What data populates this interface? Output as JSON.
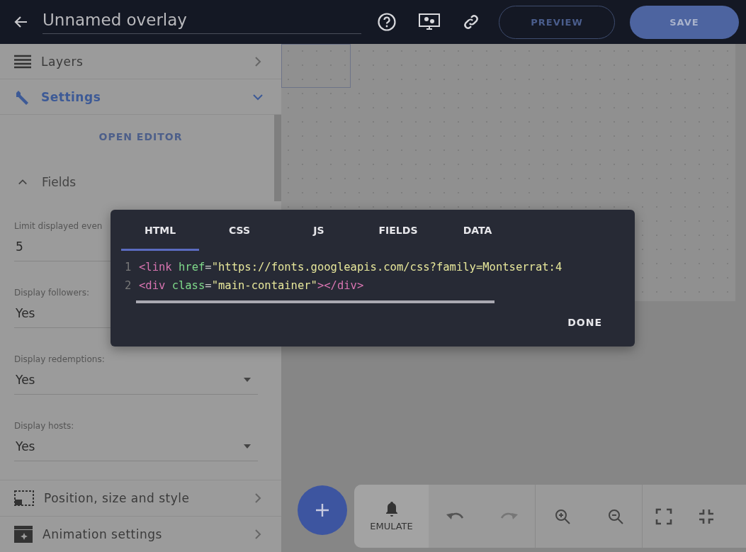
{
  "header": {
    "title": "Unnamed overlay",
    "buttons": [
      {
        "label": "PREVIEW",
        "kind": "outline"
      },
      {
        "label": "SAVE",
        "kind": "filled"
      }
    ]
  },
  "sidebar": {
    "sections": [
      {
        "label": "Layers",
        "kind": "layers",
        "expanded": false,
        "active": false
      },
      {
        "label": "Settings",
        "kind": "settings",
        "expanded": true,
        "active": true
      }
    ],
    "open_editor": "OPEN EDITOR",
    "fields_group": {
      "label": "Fields",
      "expanded": true
    },
    "fields": [
      {
        "label": "Limit displayed even",
        "value": "5",
        "kind": "input"
      },
      {
        "label": "Display followers:",
        "value": "Yes",
        "kind": "input"
      },
      {
        "label": "Display redemptions:",
        "value": "Yes",
        "kind": "select"
      },
      {
        "label": "Display hosts:",
        "value": "Yes",
        "kind": "select"
      }
    ],
    "bottom_sections": [
      {
        "label": "Position, size and style",
        "kind": "position"
      },
      {
        "label": "Animation settings",
        "kind": "animation"
      }
    ]
  },
  "toolbar": {
    "emulate": "EMULATE"
  },
  "editor": {
    "tabs": [
      {
        "label": "HTML",
        "selected": true
      },
      {
        "label": "CSS",
        "selected": false
      },
      {
        "label": "JS",
        "selected": false
      },
      {
        "label": "FIELDS",
        "selected": false
      },
      {
        "label": "DATA",
        "selected": false
      }
    ],
    "lines": [
      {
        "number": "1",
        "tokens": [
          {
            "kind": "tag",
            "text": "<link"
          },
          {
            "kind": "attr",
            "text": "href"
          },
          {
            "kind": "punct",
            "text": "="
          },
          {
            "kind": "string",
            "text": "\"https://fonts.googleapis.com/css?family=Montserrat:4"
          }
        ]
      },
      {
        "number": "2",
        "tokens": [
          {
            "kind": "tag",
            "text": "<div"
          },
          {
            "kind": "attr",
            "text": "class"
          },
          {
            "kind": "punct",
            "text": "="
          },
          {
            "kind": "string",
            "text": "\"main-container\""
          },
          {
            "kind": "tag",
            "text": "></div>"
          }
        ]
      }
    ],
    "done": "DONE"
  }
}
